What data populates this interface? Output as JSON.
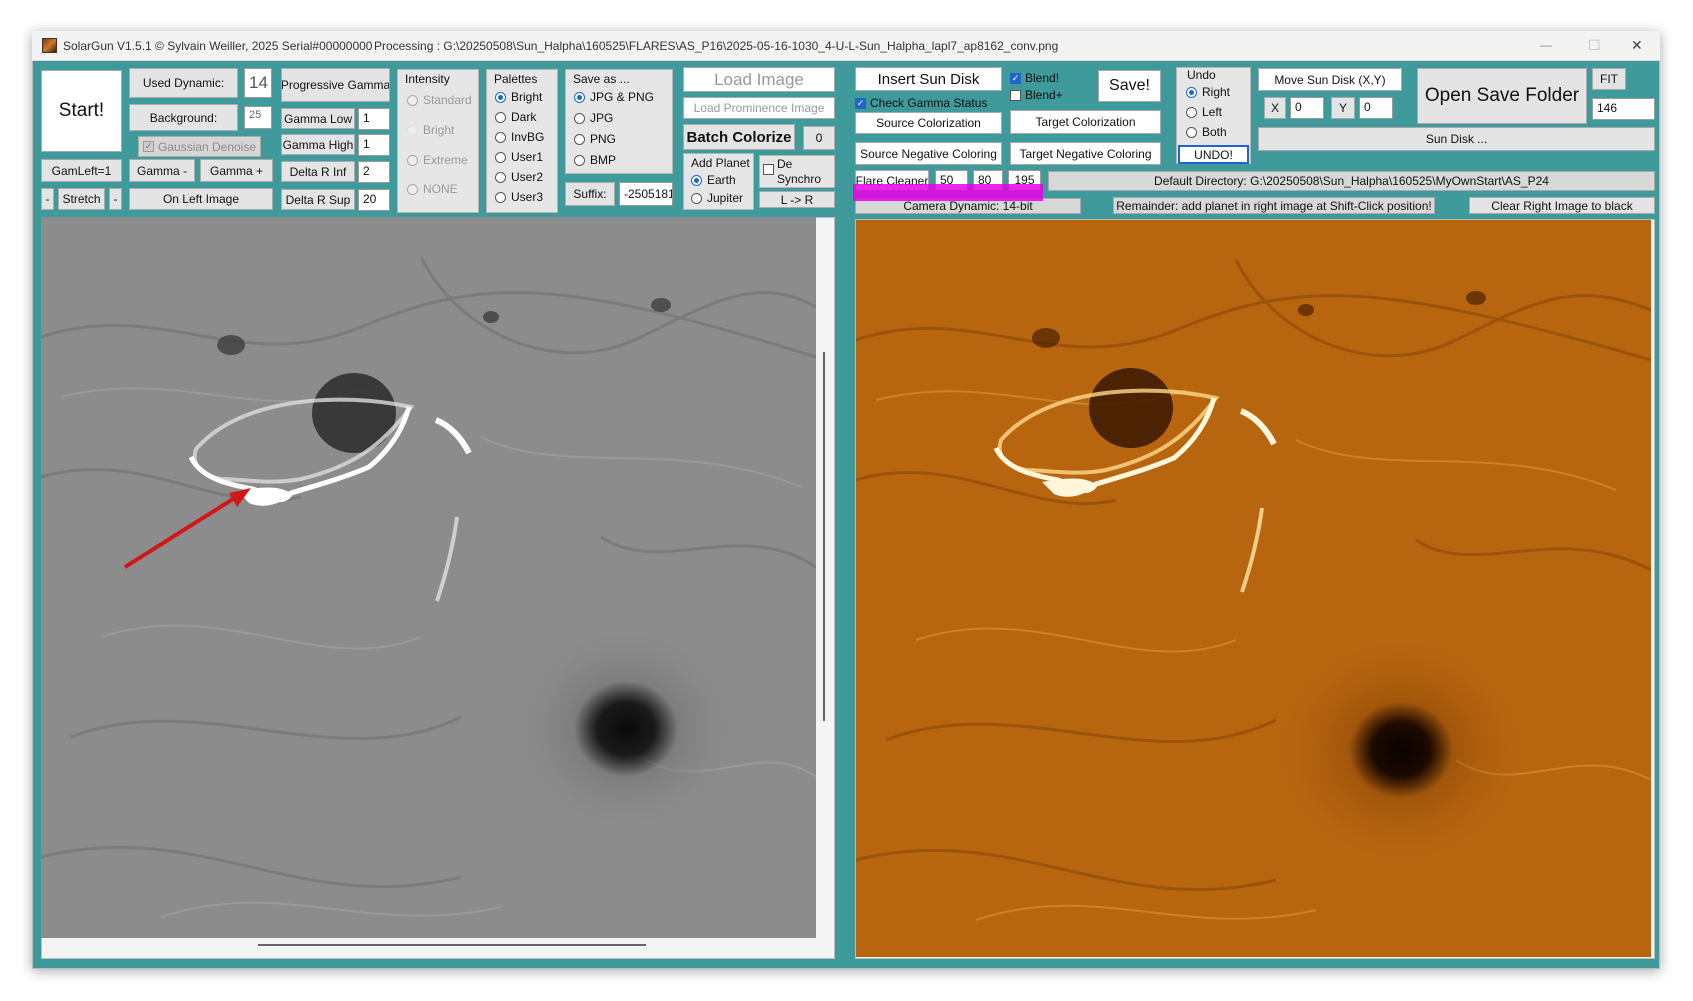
{
  "title_bar": {
    "app": "SolarGun V1.5.1 © Sylvain Weiller, 2025 Serial#00000000",
    "processing": "Processing : G:\\20250508\\Sun_Halpha\\160525\\FLARES\\AS_P16\\2025-05-16-1030_4-U-L-Sun_Halpha_lapl7_ap8162_conv.png",
    "minimize": "—",
    "maximize": "☐",
    "close": "✕"
  },
  "left_panel": {
    "start": "Start!",
    "used_dynamic": "Used Dynamic:",
    "used_dynamic_value": "14",
    "background": "Background:",
    "background_value": "25",
    "gaussian_denoise": "Gaussian Denoise",
    "gamleft": "GamLeft=1",
    "gamma_minus": "Gamma -",
    "gamma_plus": "Gamma +",
    "stretch_minus": "-",
    "stretch": "Stretch",
    "stretch_plus": "-",
    "on_left_image": "On Left Image",
    "progressive_gamma": "Progressive Gamma",
    "gamma_low": "Gamma Low",
    "gamma_low_value": "1",
    "gamma_high": "Gamma High",
    "gamma_high_value": "1",
    "delta_r_inf": "Delta R Inf",
    "delta_r_inf_value": "2",
    "delta_r_sup": "Delta R Sup",
    "delta_r_sup_value": "20"
  },
  "intensity": {
    "title": "Intensity",
    "options": [
      "Standard",
      "Bright",
      "Extreme",
      "NONE"
    ]
  },
  "palettes": {
    "title": "Palettes",
    "options": [
      "Bright",
      "Dark",
      "InvBG",
      "User1",
      "User2",
      "User3"
    ],
    "selected": "Bright"
  },
  "save_as": {
    "title": "Save as ...",
    "options": [
      "JPG & PNG",
      "JPG",
      "PNG",
      "BMP"
    ],
    "selected": "JPG & PNG",
    "suffix_label": "Suffix:",
    "suffix_value": "-2505181"
  },
  "load": {
    "load_image": "Load Image",
    "load_prominence": "Load Prominence Image",
    "batch_colorize": "Batch Colorize",
    "batch_count": "0",
    "add_planet": "Add Planet",
    "planet_options": [
      "Earth",
      "Jupiter"
    ],
    "planet_selected": "Earth",
    "de_synchro": "De Synchro",
    "l_to_r": "L -> R"
  },
  "right_controls": {
    "insert_sun_disk": "Insert Sun Disk",
    "check_gamma_status": "Check Gamma Status",
    "source_colorization": "Source Colorization",
    "target_colorization": "Target Colorization",
    "source_negative": "Source Negative Coloring",
    "target_negative": "Target Negative Coloring",
    "blend": "Blend!",
    "blend_plus": "Blend+",
    "save": "Save!",
    "flare_cleaner": "Flare Cleaner",
    "flare_values": [
      "50",
      "80",
      "195"
    ],
    "camera_dynamic": "Camera Dynamic: 14-bit",
    "undo_title": "Undo",
    "undo_options": [
      "Right",
      "Left",
      "Both"
    ],
    "undo_selected": "Right",
    "undo_button": "UNDO!",
    "move_sun_disk": "Move Sun Disk (X,Y)",
    "x_label": "X",
    "x_value": "0",
    "y_label": "Y",
    "y_value": "0",
    "sun_disk": "Sun Disk ...",
    "open_save_folder": "Open Save Folder",
    "fit": "FIT",
    "fit_value": "146",
    "default_directory": "Default Directory: G:\\20250508\\Sun_Halpha\\160525\\MyOwnStart\\AS_P24",
    "remainder": "Remainder: add planet in right image at Shift-Click position!",
    "clear_right": "Clear Right Image to black"
  },
  "colors": {
    "window_bg": "#3f9a9b",
    "highlight": "#e600e6",
    "arrow": "#d01818",
    "radio_accent": "#1e66c9"
  }
}
